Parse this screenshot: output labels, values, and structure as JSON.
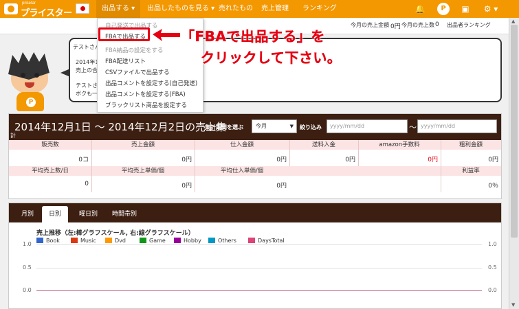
{
  "app": {
    "logo_small": "prisetar",
    "logo_big": "プライスター"
  },
  "nav": {
    "items": [
      {
        "label": "出品する ▾"
      },
      {
        "label": "出品したものを見る ▾"
      },
      {
        "label": "売れたもの"
      },
      {
        "label": "売上管理"
      },
      {
        "label": "ランキング"
      }
    ],
    "icons": [
      "bell-icon",
      "p-icon",
      "user-icon",
      "gear-icon"
    ],
    "icon_glyphs": [
      "🔔",
      "P",
      "▣",
      "⚙ ▾"
    ]
  },
  "stats": {
    "sales_amount_label": "今月の売上金額",
    "sales_amount_value": "0円",
    "sales_count_label": "今月の売上数",
    "sales_count_value": "0",
    "ranking_label": "出品者ランキング"
  },
  "dropdown": {
    "items": [
      "自己発送で出品する",
      "FBAで出品する",
      "FBA納品の設定をする",
      "FBA配送リスト",
      "CSVファイルで出品する",
      "出品コメントを設定する(自己発送)",
      "出品コメントを設定する(FBA)",
      "ブラックリスト商品を設定する"
    ]
  },
  "callout": {
    "line1": "「FBAで出品する」を",
    "line2": "クリックして下さい。"
  },
  "bubble": {
    "line1": "テストさん",
    "line2": "2014年10",
    "line3": "売上の合",
    "line4": "テストさん",
    "line5": "ボクも一"
  },
  "summary": {
    "date_text": "2014年12月1日 ～ 2014年12月2日の売上集",
    "date_tail": "計",
    "period_label": "集計期間を選ぶ",
    "period_select": "今月",
    "filter_label": "絞り込み",
    "date_placeholder_1": "yyyy/mm/dd",
    "tilde": "～",
    "date_placeholder_2": "yyyy/mm/dd",
    "row1_headers": [
      "販売数",
      "売上金額",
      "仕入金額",
      "送料入金",
      "amazon手数料",
      "粗利金額"
    ],
    "row1_values": [
      "0コ",
      "0円",
      "0円",
      "0円",
      "0円",
      "0円"
    ],
    "row2_headers": [
      "平均売上数/日",
      "平均売上単価/個",
      "平均仕入単価/個",
      "利益率"
    ],
    "row2_values": [
      "0",
      "0円",
      "0円",
      "0％"
    ],
    "accent_red": "#e60012"
  },
  "chart": {
    "tabs": [
      "月別",
      "日別",
      "曜日別",
      "時間帯別"
    ],
    "active_tab": 1
  },
  "chart_data": {
    "type": "line",
    "title": "売上推移（左:棒グラフスケール, 右:線グラフスケール）",
    "series": [
      {
        "name": "Book",
        "color": "#3366cc",
        "values": []
      },
      {
        "name": "Music",
        "color": "#dc3912",
        "values": []
      },
      {
        "name": "Dvd",
        "color": "#ff9900",
        "values": []
      },
      {
        "name": "Game",
        "color": "#109618",
        "values": []
      },
      {
        "name": "Hobby",
        "color": "#990099",
        "values": []
      },
      {
        "name": "Others",
        "color": "#0099c6",
        "values": []
      },
      {
        "name": "DaysTotal",
        "color": "#dd4477",
        "values": []
      }
    ],
    "yticks_left": [
      "1.0",
      "0.5",
      "0.0"
    ],
    "yticks_right": [
      "1.0",
      "0.5",
      "0.0"
    ],
    "ylim": [
      0,
      1
    ]
  }
}
